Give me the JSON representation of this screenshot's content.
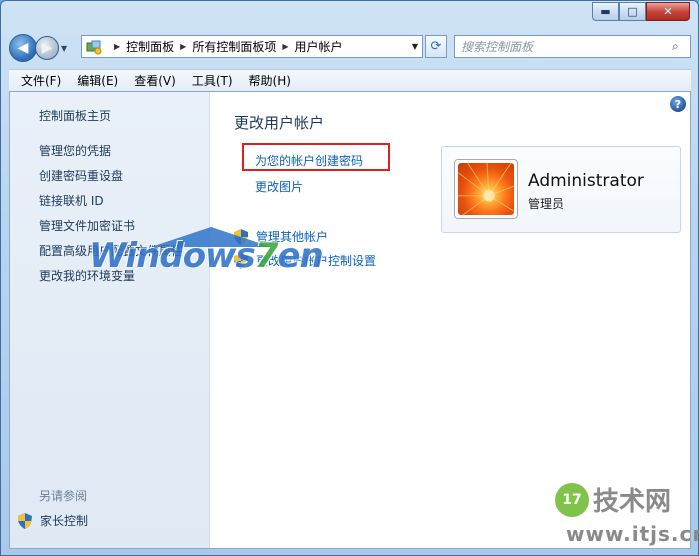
{
  "window": {
    "caption_buttons": {
      "minimize": "▬",
      "maximize": "□",
      "close": "✕"
    }
  },
  "nav": {
    "back_icon": "◀",
    "forward_icon": "▶",
    "dropdown_icon": "▼"
  },
  "address": {
    "crumbs": [
      "控制面板",
      "所有控制面板项",
      "用户帐户"
    ],
    "dropdown_icon": "▼",
    "refresh_icon": "⟳"
  },
  "search": {
    "placeholder": "搜索控制面板",
    "icon": "⌕"
  },
  "menubar": {
    "items": [
      "文件(F)",
      "编辑(E)",
      "查看(V)",
      "工具(T)",
      "帮助(H)"
    ]
  },
  "sidebar": {
    "home": "控制面板主页",
    "links": [
      "管理您的凭据",
      "创建密码重设盘",
      "链接联机 ID",
      "管理文件加密证书",
      "配置高级用户配置文件属性",
      "更改我的环境变量"
    ],
    "see_also": "另请参阅",
    "parental": "家长控制"
  },
  "main": {
    "help_icon": "?",
    "title": "更改用户帐户",
    "links": {
      "create_password": "为您的帐户创建密码",
      "change_picture": "更改图片"
    },
    "tasks": {
      "manage_other": "管理其他帐户",
      "uac_settings": "更改用户帐户控制设置"
    }
  },
  "account": {
    "name": "Administrator",
    "role": "管理员"
  },
  "watermark": {
    "win7_a": "Windows",
    "win7_b": "7",
    "win7_c": "en",
    "itjs_badge": "17",
    "itjs_title": "技术网",
    "itjs_url": "www.itjs.cn"
  },
  "colors": {
    "link": "#0b63b8",
    "highlight": "#e01e1e",
    "sidebar_text": "#1e395b"
  }
}
